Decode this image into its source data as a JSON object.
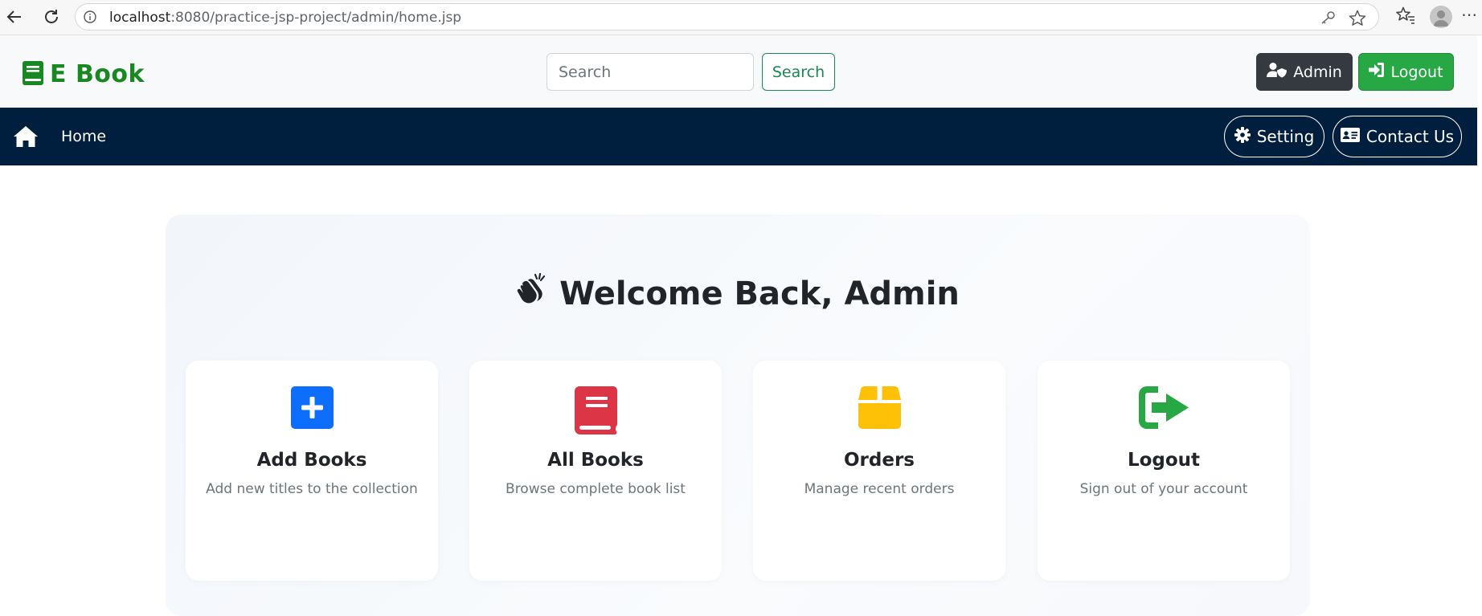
{
  "browser": {
    "url_host": "localhost",
    "url_rest": ":8080/practice-jsp-project/admin/home.jsp"
  },
  "header": {
    "brand": "E Book",
    "search_placeholder": "Search",
    "search_button": "Search",
    "admin_button": "Admin",
    "logout_button": "Logout"
  },
  "nav": {
    "home": "Home",
    "setting": "Setting",
    "contact": "Contact Us"
  },
  "main": {
    "welcome": "Welcome Back, Admin",
    "cards": [
      {
        "title": "Add Books",
        "subtitle": "Add new titles to the collection",
        "icon": "plus-square-icon",
        "color": "#0d6efd"
      },
      {
        "title": "All Books",
        "subtitle": "Browse complete book list",
        "icon": "book-icon",
        "color": "#dc3545"
      },
      {
        "title": "Orders",
        "subtitle": "Manage recent orders",
        "icon": "box-icon",
        "color": "#ffc107"
      },
      {
        "title": "Logout",
        "subtitle": "Sign out of your account",
        "icon": "sign-out-icon",
        "color": "#28a745"
      }
    ]
  },
  "colors": {
    "brand": "#198722",
    "navbar": "#001f3f",
    "dark_button": "#343a40",
    "success": "#28a745"
  }
}
